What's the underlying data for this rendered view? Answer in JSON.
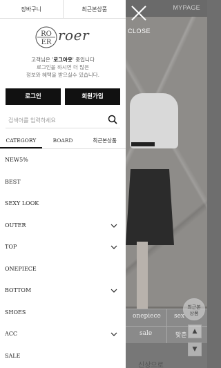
{
  "drawer": {
    "top_tabs": [
      "장바구니",
      "최근본상품"
    ],
    "logo": {
      "mark_letters": [
        "RO",
        "ER"
      ],
      "wordmark": "roer"
    },
    "greeting": {
      "prefix": "고객님은 '",
      "highlight": "로그아웃",
      "suffix": "' 중입니다"
    },
    "sub_lines": [
      "로그인을 하시면 더 많은",
      "정보와 혜택을 받으실수 있습니다."
    ],
    "buttons": {
      "login": "로그인",
      "signup": "회원가입"
    },
    "search": {
      "placeholder": "검색어를 입력하세요",
      "value": ""
    },
    "category_tabs": [
      {
        "label": "CATEGORY",
        "active": true
      },
      {
        "label": "BOARD",
        "active": false
      },
      {
        "label": "최근본상품",
        "active": false
      }
    ],
    "categories": [
      {
        "label": "NEW5%",
        "has_children": false
      },
      {
        "label": "BEST",
        "has_children": false
      },
      {
        "label": "SEXY LOOK",
        "has_children": false
      },
      {
        "label": "OUTER",
        "has_children": true
      },
      {
        "label": "TOP",
        "has_children": true
      },
      {
        "label": "ONEPIECE",
        "has_children": false
      },
      {
        "label": "BOTTOM",
        "has_children": true
      },
      {
        "label": "SHOES",
        "has_children": false
      },
      {
        "label": "ACC",
        "has_children": true
      },
      {
        "label": "SALE",
        "has_children": false
      }
    ]
  },
  "overlay": {
    "close_label": "CLOSE",
    "bg_topbar": "MYPAGE",
    "bg_table": [
      [
        "onepiece",
        "sex"
      ],
      [
        "sale",
        "맞춘"
      ]
    ],
    "bg_bottom_text": "신상으로",
    "recent_button": [
      "최근본",
      "상품"
    ],
    "scroll_up": "▲",
    "scroll_down": "▼"
  }
}
